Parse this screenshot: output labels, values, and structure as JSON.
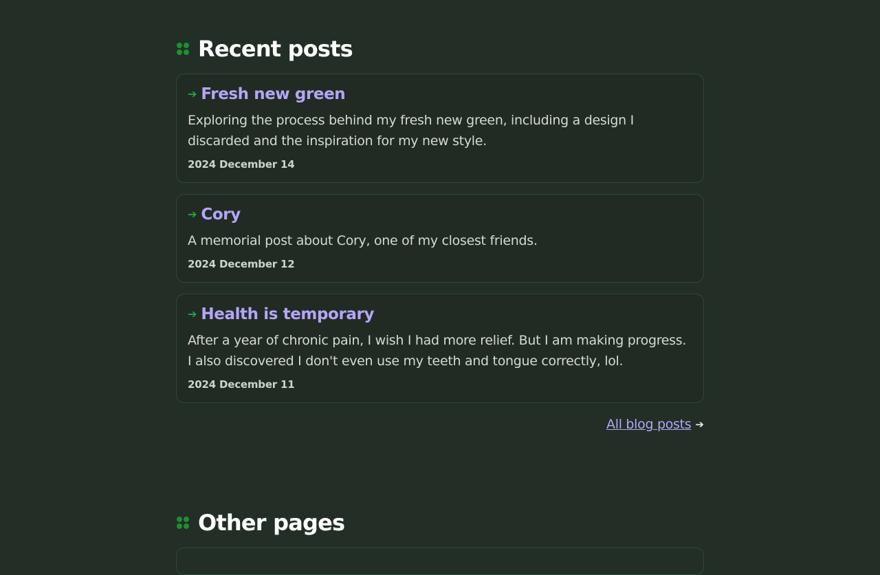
{
  "recent": {
    "heading": "Recent posts",
    "posts": [
      {
        "title": "Fresh new green",
        "description": "Exploring the process behind my fresh new green, including a design I discarded and the inspiration for my new style.",
        "date": "2024 December 14"
      },
      {
        "title": "Cory",
        "description": "A memorial post about Cory, one of my closest friends.",
        "date": "2024 December 12"
      },
      {
        "title": "Health is temporary",
        "description": "After a year of chronic pain, I wish I had more relief. But I am making progress. I also discovered I don't even use my teeth and tongue correctly, lol.",
        "date": "2024 December 11"
      }
    ],
    "all_posts_label": "All blog posts"
  },
  "other": {
    "heading": "Other pages"
  },
  "icons": {
    "section": "dots-icon",
    "post_arrow": "arrow-right-icon",
    "link_arrow": "arrow-right-icon"
  },
  "colors": {
    "background": "#222e26",
    "accent_green": "#1f8f2f",
    "link_purple": "#b4a6f7",
    "heading_white": "#ffffff"
  }
}
